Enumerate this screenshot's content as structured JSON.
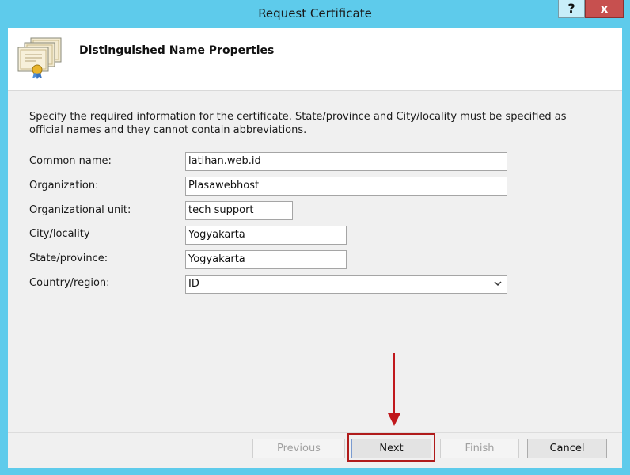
{
  "window": {
    "title": "Request Certificate",
    "help_label": "?",
    "close_label": "x"
  },
  "header": {
    "title": "Distinguished Name Properties",
    "icon": "certificate-icon"
  },
  "description": "Specify the required information for the certificate. State/province and City/locality must be specified as official names and they cannot contain abbreviations.",
  "fields": {
    "common_name": {
      "label": "Common name:",
      "value": "latihan.web.id"
    },
    "organization": {
      "label": "Organization:",
      "value": "Plasawebhost"
    },
    "org_unit": {
      "label": "Organizational unit:",
      "value": "tech support"
    },
    "city": {
      "label": "City/locality",
      "value": "Yogyakarta"
    },
    "state": {
      "label": "State/province:",
      "value": "Yogyakarta"
    },
    "country": {
      "label": "Country/region:",
      "value": "ID"
    }
  },
  "buttons": {
    "previous": "Previous",
    "next": "Next",
    "finish": "Finish",
    "cancel": "Cancel"
  },
  "colors": {
    "title_bar": "#5ecbeb",
    "close": "#c7504f",
    "highlight": "#b01b1b"
  }
}
